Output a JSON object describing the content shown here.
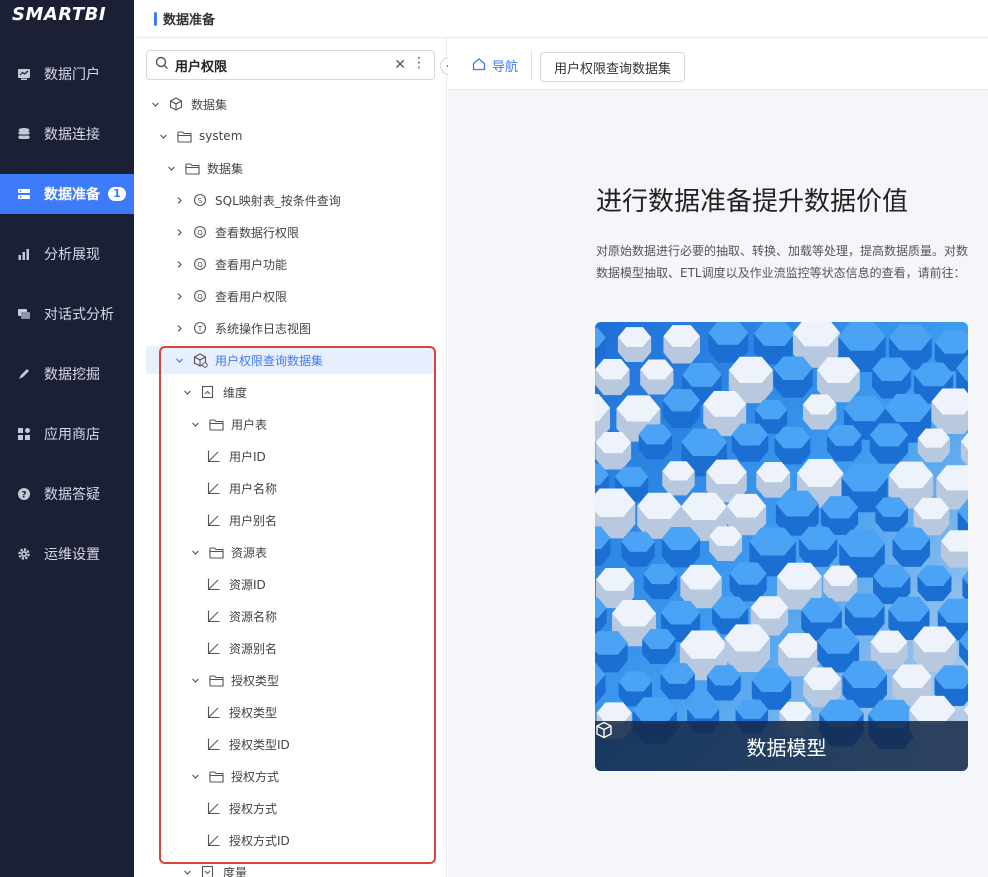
{
  "app": {
    "logo": "SMARTBI"
  },
  "nav": {
    "items": [
      {
        "label": "数据门户",
        "icon": "portal-icon"
      },
      {
        "label": "数据连接",
        "icon": "database-icon"
      },
      {
        "label": "数据准备",
        "icon": "prepare-icon",
        "badge": "1",
        "active": true
      },
      {
        "label": "分析展现",
        "icon": "bar-chart-icon"
      },
      {
        "label": "对话式分析",
        "icon": "chat-icon"
      },
      {
        "label": "数据挖掘",
        "icon": "mining-icon"
      },
      {
        "label": "应用商店",
        "icon": "app-store-icon"
      },
      {
        "label": "数据答疑",
        "icon": "help-icon"
      },
      {
        "label": "运维设置",
        "icon": "gear-icon"
      }
    ]
  },
  "header": {
    "title": "数据准备"
  },
  "search": {
    "value": "用户权限",
    "placeholder": ""
  },
  "tree": [
    {
      "label": "数据集",
      "level": 0,
      "type": "dataset-root",
      "expanded": true
    },
    {
      "label": "system",
      "level": 1,
      "type": "folder",
      "expanded": true
    },
    {
      "label": "数据集",
      "level": 2,
      "type": "folder",
      "expanded": true
    },
    {
      "label": "SQL映射表_按条件查询",
      "level": 3,
      "type": "sql-query",
      "expanded": false
    },
    {
      "label": "查看数据行权限",
      "level": 3,
      "type": "query",
      "expanded": false
    },
    {
      "label": "查看用户功能",
      "level": 3,
      "type": "query",
      "expanded": false
    },
    {
      "label": "查看用户权限",
      "level": 3,
      "type": "query",
      "expanded": false
    },
    {
      "label": "系统操作日志视图",
      "level": 3,
      "type": "text-query",
      "expanded": false
    },
    {
      "label": "用户权限查询数据集",
      "level": 3,
      "type": "model",
      "expanded": true,
      "selected": true
    },
    {
      "label": "维度",
      "level": 4,
      "type": "dimension",
      "expanded": true
    },
    {
      "label": "用户表",
      "level": 5,
      "type": "folder",
      "expanded": true
    },
    {
      "label": "用户ID",
      "level": 6,
      "type": "field"
    },
    {
      "label": "用户名称",
      "level": 6,
      "type": "field"
    },
    {
      "label": "用户别名",
      "level": 6,
      "type": "field"
    },
    {
      "label": "资源表",
      "level": 5,
      "type": "folder",
      "expanded": true
    },
    {
      "label": "资源ID",
      "level": 6,
      "type": "field"
    },
    {
      "label": "资源名称",
      "level": 6,
      "type": "field"
    },
    {
      "label": "资源别名",
      "level": 6,
      "type": "field"
    },
    {
      "label": "授权类型",
      "level": 5,
      "type": "folder",
      "expanded": true
    },
    {
      "label": "授权类型",
      "level": 6,
      "type": "field"
    },
    {
      "label": "授权类型ID",
      "level": 6,
      "type": "field"
    },
    {
      "label": "授权方式",
      "level": 5,
      "type": "folder",
      "expanded": true
    },
    {
      "label": "授权方式",
      "level": 6,
      "type": "field"
    },
    {
      "label": "授权方式ID",
      "level": 6,
      "type": "field"
    },
    {
      "label": "度量",
      "level": 4,
      "type": "measure",
      "expanded": true
    }
  ],
  "tabs": {
    "nav_label": "导航",
    "dataset_label": "用户权限查询数据集"
  },
  "hero": {
    "title": "进行数据准备提升数据价值",
    "desc_line1": "对原始数据进行必要的抽取、转换、加载等处理，提高数据质量。对数",
    "desc_line2": "数据模型抽取、ETL调度以及作业流监控等状态信息的查看，请前往："
  },
  "card": {
    "label": "数据模型"
  },
  "colors": {
    "accent": "#3e7bfa",
    "nav_bg": "#1b2036",
    "highlight": "#d9443a"
  }
}
